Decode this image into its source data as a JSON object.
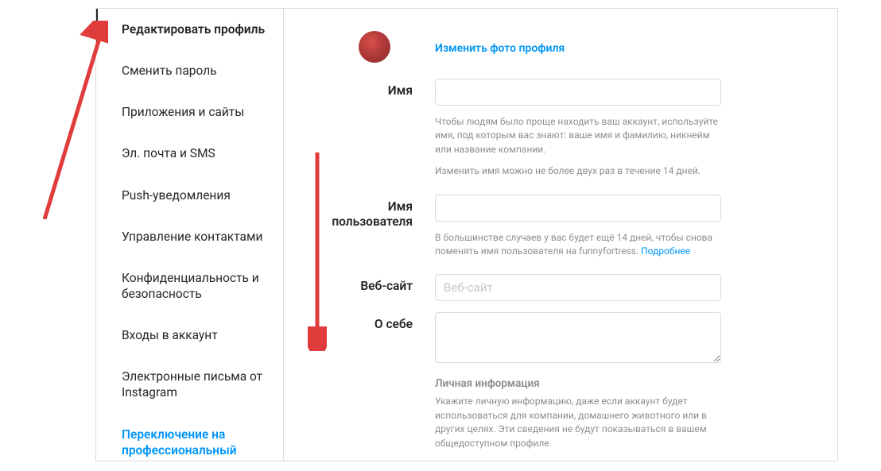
{
  "sidebar": {
    "items": [
      {
        "label": "Редактировать профиль",
        "active": true
      },
      {
        "label": "Сменить пароль"
      },
      {
        "label": "Приложения и сайты"
      },
      {
        "label": "Эл. почта и SMS"
      },
      {
        "label": "Push-уведомления"
      },
      {
        "label": "Управление контактами"
      },
      {
        "label": "Конфиденциальность и безопасность"
      },
      {
        "label": "Входы в аккаунт"
      },
      {
        "label": "Электронные письма от Instagram"
      },
      {
        "label": "Переключение на профессиональный",
        "link": true
      }
    ]
  },
  "profile": {
    "change_photo": "Изменить фото профиля",
    "name_label": "Имя",
    "name_hint1": "Чтобы людям было проще находить ваш аккаунт, используйте имя, под которым вас знают: ваше имя и фамилию, никнейм или название компании.",
    "name_hint2": "Изменить имя можно не более двух раз в течение 14 дней.",
    "username_label": "Имя пользователя",
    "username_hint_prefix": "В большинстве случаев у вас будет ещё 14 дней, чтобы снова поменять имя пользователя на funnyfortress. ",
    "username_hint_link": "Подробнее",
    "website_label": "Веб-сайт",
    "website_placeholder": "Веб-сайт",
    "bio_label": "О себе",
    "personal_head": "Личная информация",
    "personal_hint": "Укажите личную информацию, даже если аккаунт будет использоваться для компании, домашнего животного или в других целях. Эти сведения не будут показываться в вашем общедоступном профиле."
  }
}
